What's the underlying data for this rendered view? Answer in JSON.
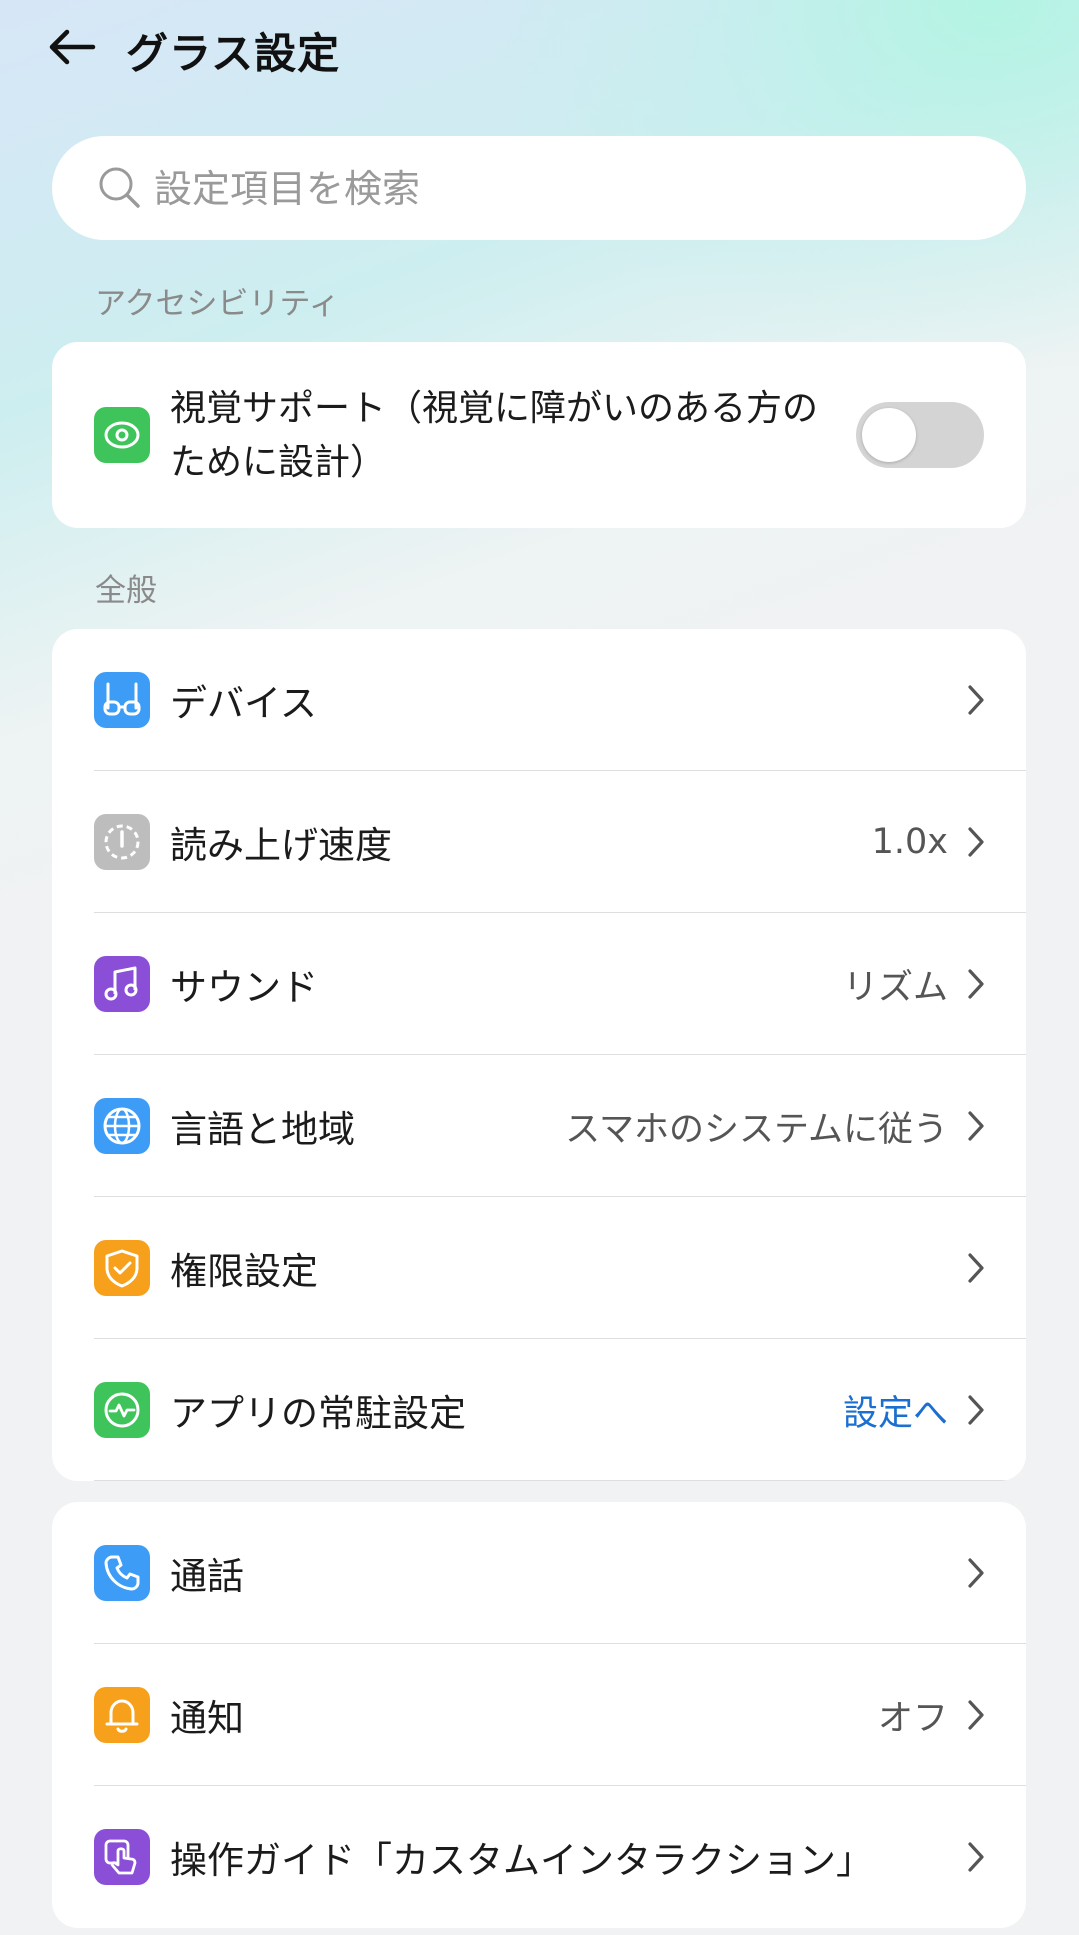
{
  "header": {
    "title": "グラス設定"
  },
  "search": {
    "placeholder": "設定項目を検索"
  },
  "accessibility": {
    "section_label": "アクセシビリティ",
    "vision_support": {
      "label": "視覚サポート（視覚に障がいのある方のために設計）",
      "enabled": false
    }
  },
  "general": {
    "section_label": "全般",
    "items": [
      {
        "label": "デバイス",
        "value": ""
      },
      {
        "label": "読み上げ速度",
        "value": "1.0x"
      },
      {
        "label": "サウンド",
        "value": "リズム"
      },
      {
        "label": "言語と地域",
        "value": "スマホのシステムに従う"
      },
      {
        "label": "権限設定",
        "value": ""
      },
      {
        "label": "アプリの常駐設定",
        "value": "設定へ"
      }
    ]
  },
  "other": {
    "items": [
      {
        "label": "通話",
        "value": ""
      },
      {
        "label": "通知",
        "value": "オフ"
      },
      {
        "label": "操作ガイド「カスタムインタラクション」",
        "value": ""
      }
    ]
  },
  "colors": {
    "green": "#3ec45a",
    "blue": "#3c9cf6",
    "gray": "#bdbdbd",
    "purple": "#8a4fd6",
    "orange": "#f7a01c",
    "link": "#1a6fd1"
  }
}
